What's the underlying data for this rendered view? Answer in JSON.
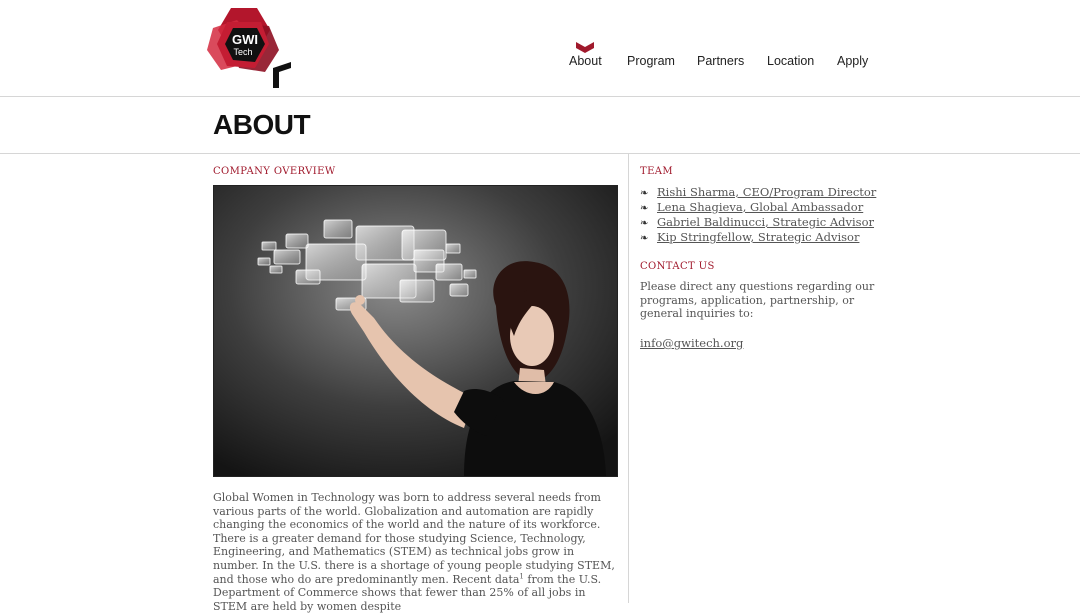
{
  "brand": {
    "logo_line1": "GWI",
    "logo_line2": "Tech",
    "accent_color": "#a0192c"
  },
  "nav": {
    "items": [
      {
        "label": "About",
        "active": true
      },
      {
        "label": "Program",
        "active": false
      },
      {
        "label": "Partners",
        "active": false
      },
      {
        "label": "Location",
        "active": false
      },
      {
        "label": "Apply",
        "active": false
      }
    ]
  },
  "page": {
    "title": "ABOUT"
  },
  "overview": {
    "heading": "COMPANY OVERVIEW",
    "image_icon": "woman-touching-virtual-screens-photo",
    "paragraph": {
      "part1": "Global Women in Technology was born to address several needs from various parts of the world. Globalization and automation are rapidly changing the economics of the world and the nature of its workforce. There is a greater demand for those studying Science, Technology, Engineering, and Mathematics (STEM) as technical jobs grow in number. In the U.S. there is a shortage of young people studying STEM, and those who do are predominantly men. Recent data",
      "footnote": "1",
      "part2": " from the U.S. Department of Commerce shows that fewer than 25% of all jobs in STEM are held by women despite"
    }
  },
  "team": {
    "heading": "TEAM",
    "bullet_icon": "fleuron-icon",
    "members": [
      {
        "label": "Rishi Sharma, CEO/Program Director"
      },
      {
        "label": "Lena Shagieva, Global Ambassador"
      },
      {
        "label": "Gabriel Baldinucci, Strategic Advisor"
      },
      {
        "label": "Kip Stringfellow, Strategic Advisor"
      }
    ]
  },
  "contact": {
    "heading": "CONTACT US",
    "text": "Please direct any questions regarding our programs, application, partnership, or general inquiries to:",
    "email": "info@gwitech.org"
  }
}
